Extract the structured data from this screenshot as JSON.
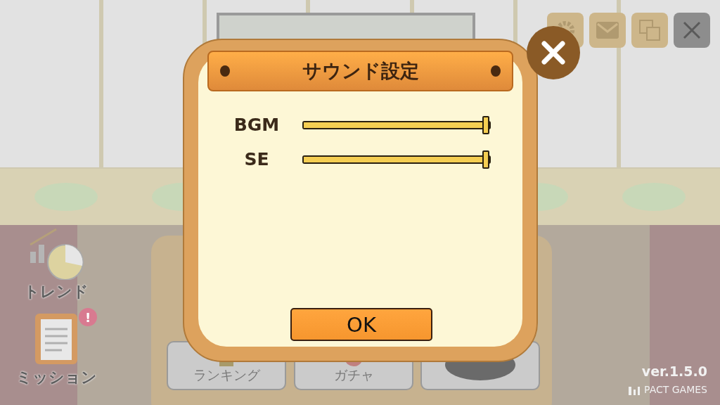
{
  "side_menu": [
    {
      "kind": "trend",
      "label": "トレンド"
    },
    {
      "kind": "mission",
      "label": "ミッション",
      "badge": "!"
    }
  ],
  "bottom_menu": [
    {
      "kind": "ranking",
      "label": "ランキング"
    },
    {
      "kind": "gacha",
      "label": "ガチャ"
    },
    {
      "kind": "bowl"
    }
  ],
  "version": "ver.1.5.0",
  "publisher": "PACT GAMES",
  "dialog": {
    "title": "サウンド設定",
    "sliders": [
      {
        "label": "BGM",
        "level": 1
      },
      {
        "label": "SE",
        "level": 1
      }
    ],
    "ok_button": "OK"
  }
}
